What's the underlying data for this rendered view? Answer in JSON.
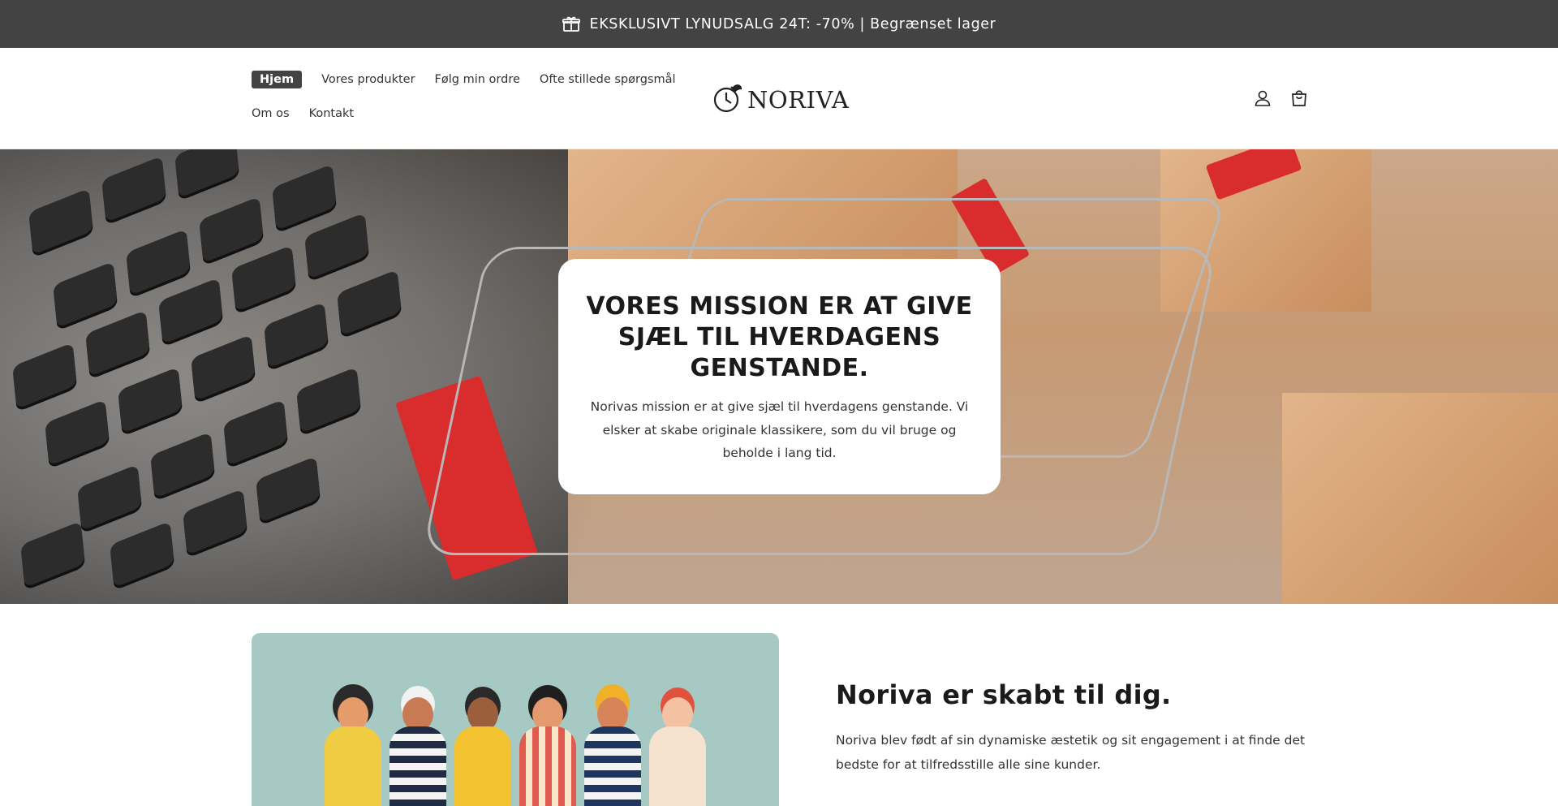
{
  "announcement": {
    "icon": "gift-box-icon",
    "text": "EKSKLUSIVT LYNUDSALG 24T: -70% | Begrænset lager"
  },
  "header": {
    "nav": [
      {
        "label": "Hjem",
        "active": true
      },
      {
        "label": "Vores produkter",
        "active": false
      },
      {
        "label": "Følg min ordre",
        "active": false
      },
      {
        "label": "Ofte stillede spørgsmål",
        "active": false
      },
      {
        "label": "Om os",
        "active": false
      },
      {
        "label": "Kontakt",
        "active": false
      }
    ],
    "logo": {
      "text": "NORIVA",
      "icon": "clock-leaf-icon"
    },
    "icons": [
      "account-icon",
      "cart-icon"
    ]
  },
  "hero": {
    "title": "VORES MISSION ER AT GIVE SJÆL TIL HVERDAGENS GENSTANDE.",
    "text": "Norivas mission er at give sjæl til hverdagens genstande. Vi elsker at skabe originale klassikere, som du vil bruge og beholde i lang tid."
  },
  "about": {
    "title": "Noriva er skabt til dig.",
    "text": "Noriva blev født af sin dynamiske æstetik og sit engagement i at finde det bedste for at tilfredsstille alle sine kunder."
  },
  "colors": {
    "announcement_bg": "#434343",
    "illustration_bg": "#a6cac3"
  }
}
